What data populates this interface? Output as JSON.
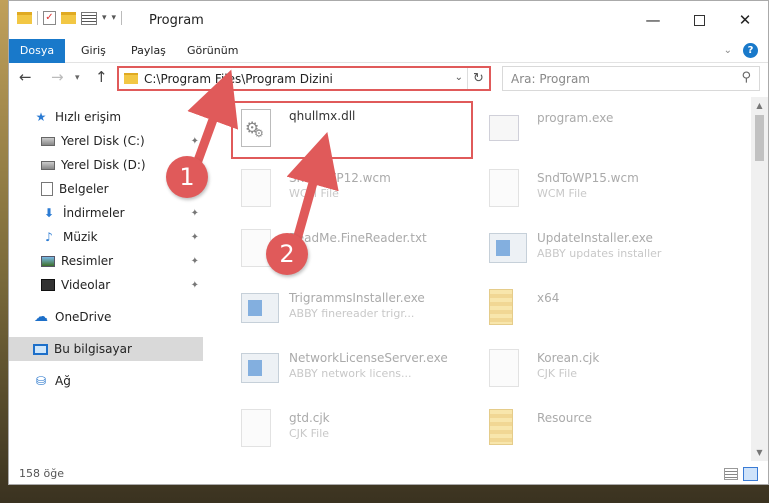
{
  "window": {
    "title": "Program",
    "min_label": "—",
    "close_label": "✕"
  },
  "ribbon": {
    "tabs": [
      "Dosya",
      "Giriş",
      "Paylaş",
      "Görünüm"
    ],
    "help": "?"
  },
  "address": {
    "path": "C:\\Program Files\\Program Dizini",
    "search_placeholder": "Ara: Program"
  },
  "sidebar": {
    "items": [
      {
        "label": "Hızlı erişim",
        "icon": "star-icon"
      },
      {
        "label": "Yerel Disk (C:)",
        "icon": "disk-icon"
      },
      {
        "label": "Yerel Disk (D:)",
        "icon": "disk-icon"
      },
      {
        "label": "Belgeler",
        "icon": "document-icon"
      },
      {
        "label": "İndirmeler",
        "icon": "download-icon"
      },
      {
        "label": "Müzik",
        "icon": "music-icon"
      },
      {
        "label": "Resimler",
        "icon": "pictures-icon"
      },
      {
        "label": "Videolar",
        "icon": "video-icon"
      },
      {
        "label": "OneDrive",
        "icon": "cloud-icon"
      },
      {
        "label": "Bu bilgisayar",
        "icon": "computer-icon"
      },
      {
        "label": "Ağ",
        "icon": "network-icon"
      }
    ]
  },
  "files": [
    {
      "name": "qhullmx.dll",
      "type": ""
    },
    {
      "name": "program.exe",
      "type": ""
    },
    {
      "name": "SndToWP12.wcm",
      "type": "WCM File"
    },
    {
      "name": "SndToWP15.wcm",
      "type": "WCM File"
    },
    {
      "name": "ReadMe.FineReader.txt",
      "type": "File"
    },
    {
      "name": "UpdateInstaller.exe",
      "type": "ABBY updates installer"
    },
    {
      "name": "TrigrammsInstaller.exe",
      "type": "ABBY finereader trigr..."
    },
    {
      "name": "x64",
      "type": ""
    },
    {
      "name": "NetworkLicenseServer.exe",
      "type": "ABBY network licens..."
    },
    {
      "name": "Korean.cjk",
      "type": "CJK File"
    },
    {
      "name": "gtd.cjk",
      "type": "CJK File"
    },
    {
      "name": "Resource",
      "type": ""
    }
  ],
  "status": {
    "count": "158 öğe"
  },
  "annotations": {
    "badge_1": "1",
    "badge_2": "2"
  },
  "colors": {
    "accent": "#1979ca",
    "annotation": "#e05a5a"
  }
}
